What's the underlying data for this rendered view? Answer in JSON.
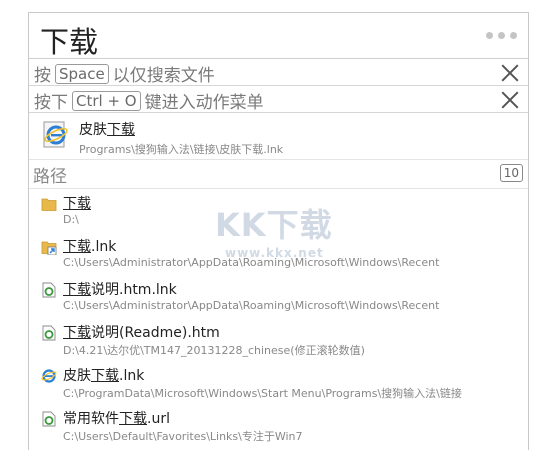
{
  "query": "下载",
  "hints": {
    "search_prefix": "按",
    "search_key": "Space",
    "search_suffix": "以仅搜索文件",
    "action_prefix": "按下",
    "action_key": "Ctrl + O",
    "action_suffix": "键进入动作菜单"
  },
  "top_result": {
    "title_before": "皮肤",
    "title_match": "下载",
    "title_after": "",
    "path": "Programs\\搜狗输入法\\链接\\皮肤下载.lnk",
    "icon": "ie-icon"
  },
  "section": {
    "title": "路径",
    "count": "10"
  },
  "items": [
    {
      "before": "",
      "match": "下载",
      "after": "",
      "path": "D:\\",
      "icon": "folder-icon"
    },
    {
      "before": "",
      "match": "下载",
      "after": ".lnk",
      "path": "C:\\Users\\Administrator\\AppData\\Roaming\\Microsoft\\Windows\\Recent",
      "icon": "folder-shortcut-icon"
    },
    {
      "before": "",
      "match": "下载",
      "after": "说明.htm.lnk",
      "path": "C:\\Users\\Administrator\\AppData\\Roaming\\Microsoft\\Windows\\Recent",
      "icon": "htm-file-icon"
    },
    {
      "before": "",
      "match": "下载",
      "after": "说明(Readme).htm",
      "path": "D:\\4.21\\达尔优\\TM147_20131228_chinese(修正滚轮数值)",
      "icon": "htm-file-icon"
    },
    {
      "before": "皮肤",
      "match": "下载",
      "after": ".lnk",
      "path": "C:\\ProgramData\\Microsoft\\Windows\\Start Menu\\Programs\\搜狗输入法\\链接",
      "icon": "ie-icon"
    },
    {
      "before": "常用软件",
      "match": "下载",
      "after": ".url",
      "path": "C:\\Users\\Default\\Favorites\\Links\\专注于Win7",
      "icon": "htm-file-icon"
    }
  ],
  "watermark": {
    "big": "KK下载",
    "small": "www.kkx.net"
  },
  "colors": {
    "folder": "#e8b84a",
    "ie_blue": "#2a7fd4",
    "ie_ring": "#f2c232",
    "htm_green": "#3a9a3a"
  }
}
